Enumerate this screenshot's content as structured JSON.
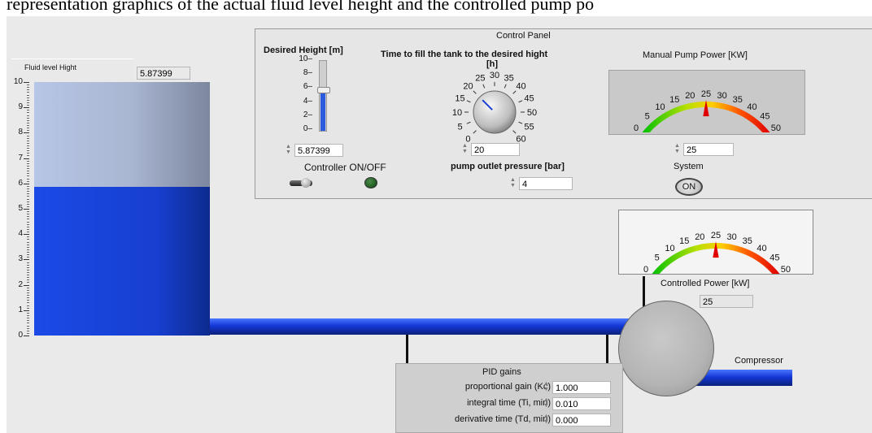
{
  "caption": "representation  graphics  of the actual fluid level height and the controlled pump po",
  "tank": {
    "label": "Fluid level Hight",
    "value_display": "5.87399",
    "level": 5.87399,
    "scale_max": 10,
    "ticks": [
      "10",
      "9",
      "8",
      "7",
      "6",
      "5",
      "4",
      "3",
      "2",
      "1",
      "0"
    ]
  },
  "control_panel": {
    "title": "Control Panel",
    "desired_height": {
      "label": "Desired Height [m]",
      "ticks": [
        "10",
        "8",
        "6",
        "4",
        "2",
        "0"
      ],
      "value": "5.87399",
      "level": 5.87399
    },
    "fill_time": {
      "label_line1": "Time to fill the tank to the desired hight",
      "label_line2": "[h]",
      "ticks": [
        "0",
        "5",
        "10",
        "15",
        "20",
        "25",
        "30",
        "35",
        "40",
        "45",
        "50",
        "55",
        "60"
      ],
      "value": "20"
    },
    "manual_pump": {
      "label": "Manual Pump Power  [KW]",
      "ticks": [
        "0",
        "5",
        "10",
        "15",
        "20",
        "25",
        "30",
        "35",
        "40",
        "45",
        "50"
      ],
      "value": "25"
    },
    "controller": {
      "label": "Controller ON/OFF"
    },
    "pump_outlet": {
      "label": "pump outlet pressure [bar]",
      "value": "4"
    },
    "system": {
      "label": "System",
      "button": "ON"
    }
  },
  "controlled_power": {
    "label": "Controlled Power [kW]",
    "ticks": [
      "0",
      "5",
      "10",
      "15",
      "20",
      "25",
      "30",
      "35",
      "40",
      "45",
      "50"
    ],
    "value": "25"
  },
  "compressor": {
    "label": "Compressor"
  },
  "pid": {
    "title": "PID gains",
    "rows": [
      {
        "label": "proportional gain (Kc)",
        "value": "1.000"
      },
      {
        "label": "integral time (Ti, min)",
        "value": "0.010"
      },
      {
        "label": "derivative time (Td, min)",
        "value": "0.000"
      }
    ]
  },
  "colors": {
    "fluid": "#1a3fd6",
    "panel": "#eaeaea",
    "led": "#1f5a1f"
  }
}
